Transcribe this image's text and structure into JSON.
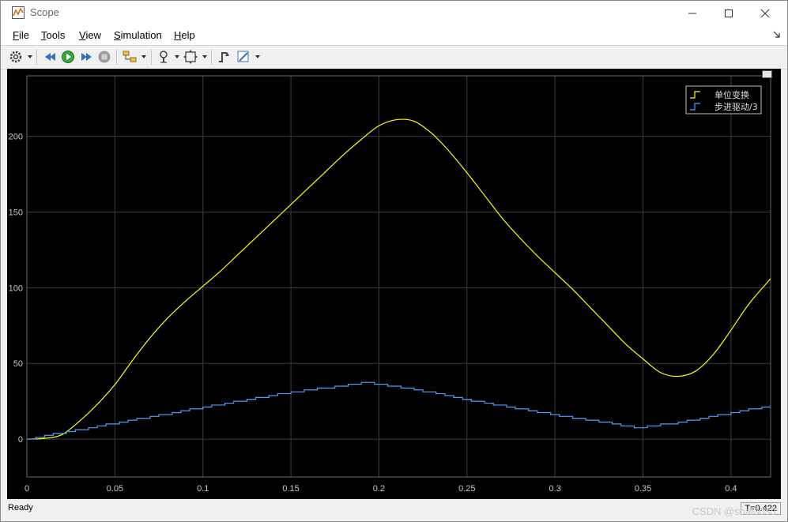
{
  "window": {
    "title": "Scope",
    "icon": "scope-app-icon"
  },
  "menu": {
    "items": [
      {
        "mnemonic": "F",
        "rest": "ile"
      },
      {
        "mnemonic": "T",
        "rest": "ools"
      },
      {
        "mnemonic": "V",
        "rest": "iew"
      },
      {
        "mnemonic": "S",
        "rest": "imulation"
      },
      {
        "mnemonic": "H",
        "rest": "elp"
      }
    ]
  },
  "toolbar": {
    "icons": [
      "gear-icon",
      "step-back-icon",
      "run-icon",
      "step-forward-icon",
      "stop-icon",
      "highlight-block-icon",
      "zoom-icon",
      "autoscale-icon",
      "trigger-icon",
      "measurements-icon"
    ]
  },
  "status": {
    "text": "Ready",
    "time": "T=0.422"
  },
  "watermark": "CSDN @soal3033",
  "colors": {
    "background": "#000000",
    "grid": "#3d3d3d",
    "axis_text": "#c8c8c8",
    "series_1": "#ffff00",
    "series_2": "#4d9fff"
  },
  "chart_data": {
    "type": "line",
    "title": "",
    "xlabel": "",
    "ylabel": "",
    "xlim": [
      0,
      0.4225
    ],
    "ylim": [
      -25,
      240
    ],
    "xticks": [
      0,
      0.05,
      0.1,
      0.15,
      0.2,
      0.25,
      0.3,
      0.35,
      0.4
    ],
    "xtick_labels": [
      "0",
      "0.05",
      "0.1",
      "0.15",
      "0.2",
      "0.25",
      "0.3",
      "0.35",
      "0.4"
    ],
    "yticks": [
      0,
      50,
      100,
      150,
      200
    ],
    "ytick_labels": [
      "0",
      "50",
      "100",
      "150",
      "200"
    ],
    "grid": true,
    "legend_position": "top-right",
    "series": [
      {
        "name": "单位变换",
        "color": "#ffff00",
        "style": "continuous",
        "points": [
          [
            0,
            0
          ],
          [
            0.01,
            0.5
          ],
          [
            0.02,
            3
          ],
          [
            0.03,
            12
          ],
          [
            0.04,
            23
          ],
          [
            0.05,
            36
          ],
          [
            0.06,
            52
          ],
          [
            0.07,
            67
          ],
          [
            0.08,
            80
          ],
          [
            0.09,
            91
          ],
          [
            0.1,
            101
          ],
          [
            0.11,
            111
          ],
          [
            0.12,
            122
          ],
          [
            0.13,
            133
          ],
          [
            0.14,
            144
          ],
          [
            0.15,
            155
          ],
          [
            0.16,
            166
          ],
          [
            0.17,
            177
          ],
          [
            0.18,
            188
          ],
          [
            0.19,
            198
          ],
          [
            0.2,
            207
          ],
          [
            0.21,
            211
          ],
          [
            0.22,
            210
          ],
          [
            0.23,
            202
          ],
          [
            0.24,
            190
          ],
          [
            0.25,
            176
          ],
          [
            0.26,
            161
          ],
          [
            0.27,
            146
          ],
          [
            0.28,
            133
          ],
          [
            0.29,
            121
          ],
          [
            0.3,
            110
          ],
          [
            0.31,
            99
          ],
          [
            0.32,
            87
          ],
          [
            0.33,
            75
          ],
          [
            0.34,
            63
          ],
          [
            0.35,
            53
          ],
          [
            0.36,
            44
          ],
          [
            0.37,
            41.5
          ],
          [
            0.38,
            45
          ],
          [
            0.39,
            56
          ],
          [
            0.4,
            72
          ],
          [
            0.41,
            89
          ],
          [
            0.4225,
            106
          ]
        ]
      },
      {
        "name": "步进驱动/3",
        "color": "#4d9fff",
        "style": "staircase",
        "points": [
          [
            0,
            0
          ],
          [
            0.0475,
            10
          ],
          [
            0.095,
            20
          ],
          [
            0.145,
            30
          ],
          [
            0.1925,
            37.5
          ],
          [
            0.22,
            33
          ],
          [
            0.25,
            26
          ],
          [
            0.3,
            16
          ],
          [
            0.348,
            7.5
          ],
          [
            0.37,
            11
          ],
          [
            0.4225,
            22
          ]
        ]
      }
    ]
  }
}
